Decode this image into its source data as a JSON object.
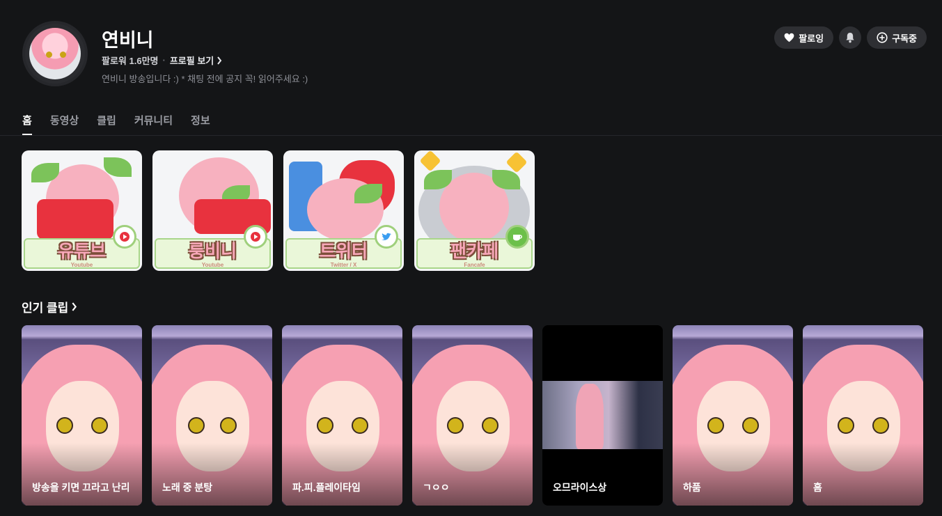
{
  "channel": {
    "name": "연비니",
    "followers": "팔로워 1.6만명",
    "profile_link": "프로필 보기",
    "description": "연비니 방송입니다 :) * 채팅 전에 공지 꼭! 읽어주세요 :)"
  },
  "actions": {
    "follow_label": "팔로잉",
    "subscribe_label": "구독중"
  },
  "tabs": [
    {
      "label": "홈",
      "active": true
    },
    {
      "label": "동영상"
    },
    {
      "label": "클립"
    },
    {
      "label": "커뮤니티"
    },
    {
      "label": "정보"
    }
  ],
  "banners": [
    {
      "label": "유튜브",
      "sub": "Youtube",
      "icon": "play-icon"
    },
    {
      "label": "룽비니",
      "sub": "Youtube",
      "icon": "play-icon"
    },
    {
      "label": "트위터",
      "sub": "Twitter / X",
      "icon": "twitter-icon"
    },
    {
      "label": "팬카페",
      "sub": "Fancafe",
      "icon": "cup-icon"
    }
  ],
  "popular_clips": {
    "title": "인기 클립",
    "items": [
      {
        "title": "방송을 키면 끄라고 난리"
      },
      {
        "title": "노래 중 분탕"
      },
      {
        "title": "파.피.플레이타임"
      },
      {
        "title": "ㄱㅇㅇ"
      },
      {
        "title": "오므라이스상"
      },
      {
        "title": "하품"
      },
      {
        "title": "흠"
      }
    ]
  },
  "colors": {
    "background": "#141517",
    "pill": "#2e2f33",
    "accent_pink": "#f7a7b8",
    "accent_green": "#9fd07c"
  }
}
